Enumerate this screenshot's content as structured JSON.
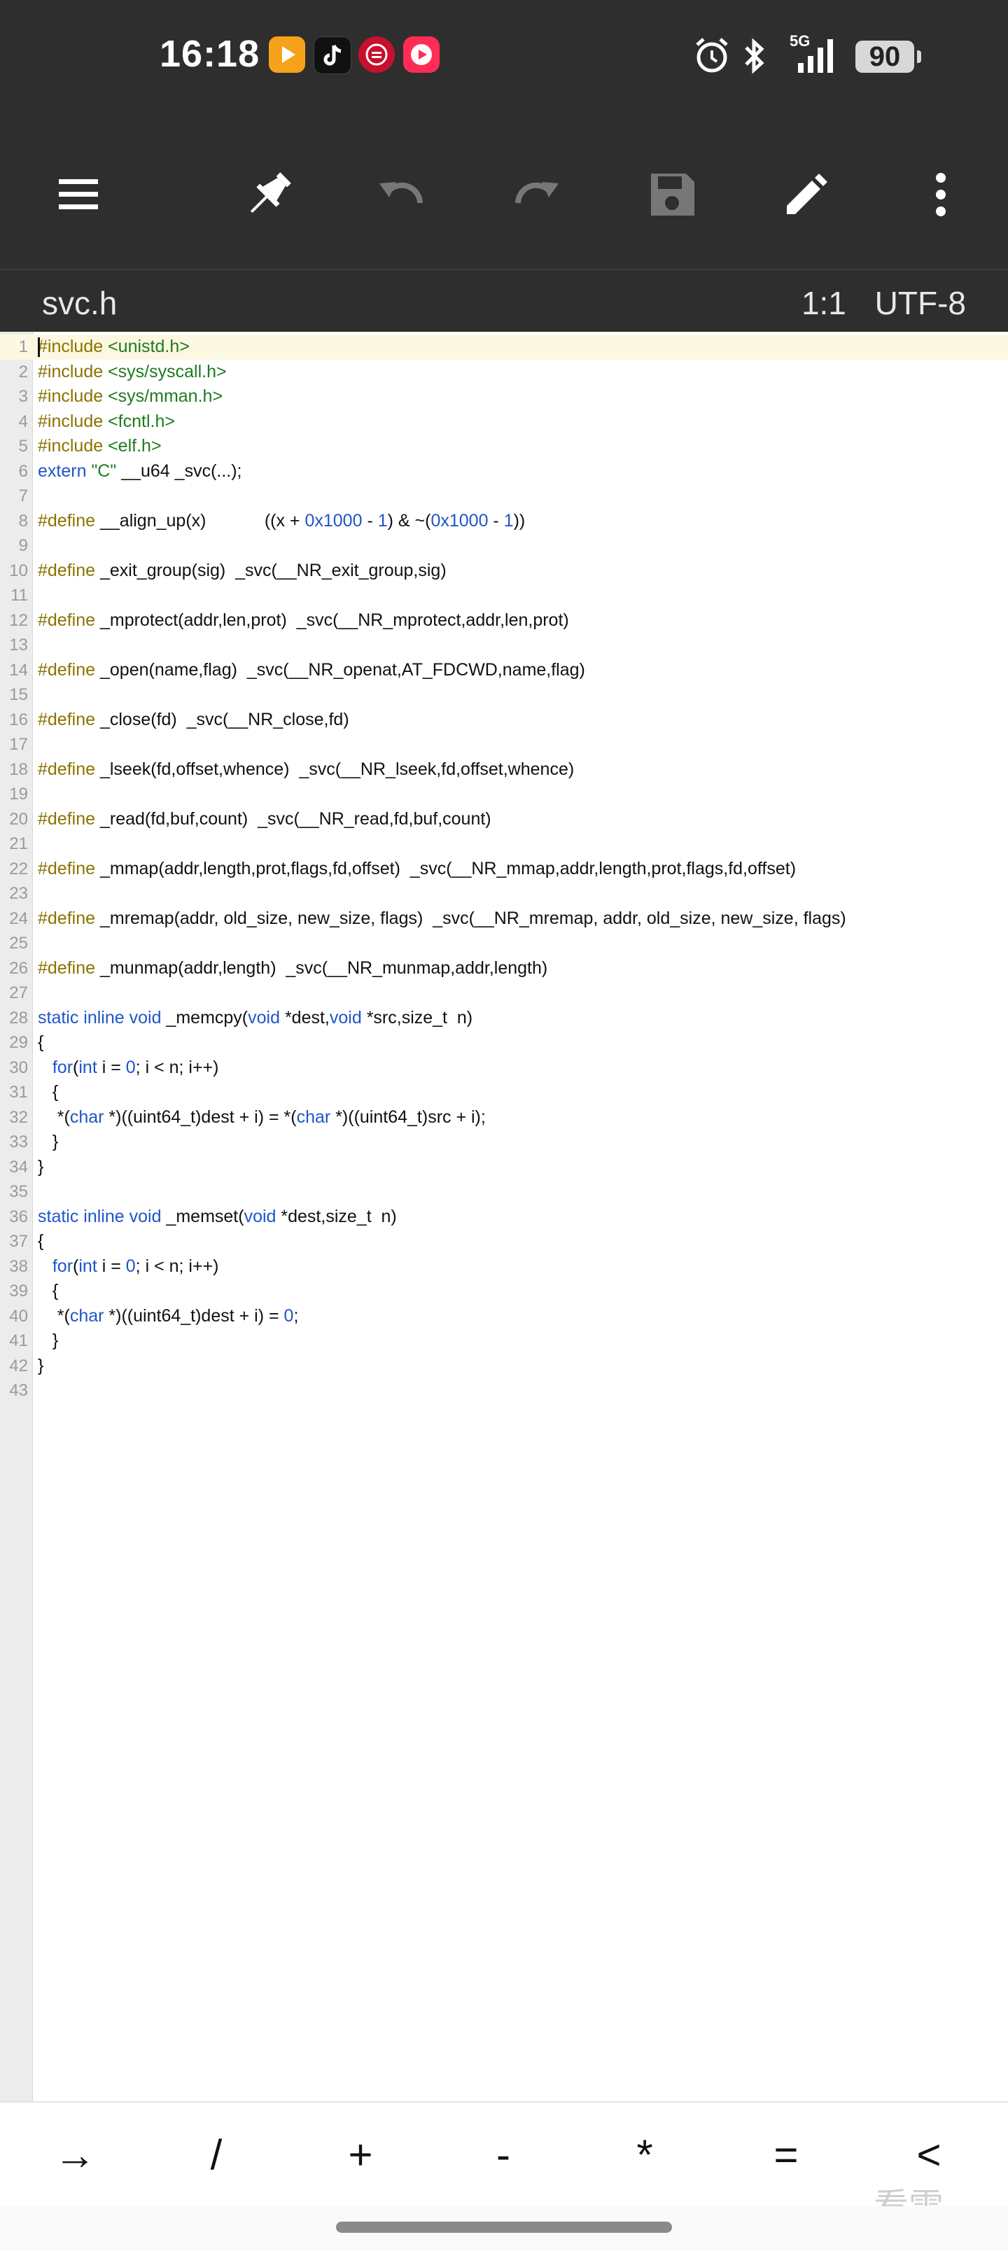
{
  "status_bar": {
    "time": "16:18",
    "network": "5G",
    "battery": "90",
    "app_icons": [
      "video-app-icon",
      "tiktok-icon",
      "red-circle-app-icon",
      "red-play-app-icon"
    ],
    "system_icons": [
      "alarm-icon",
      "bluetooth-icon",
      "signal-icon"
    ]
  },
  "toolbar": {
    "buttons": [
      "menu-icon",
      "pin-icon",
      "undo-icon",
      "redo-icon",
      "save-icon",
      "edit-icon",
      "more-icon"
    ]
  },
  "tab": {
    "filename": "svc.h",
    "cursor_position": "1:1",
    "encoding": "UTF-8"
  },
  "editor": {
    "lines": [
      [
        {
          "t": "#include",
          "c": "kw"
        },
        {
          "t": " <unistd.h>",
          "c": "inc"
        }
      ],
      [
        {
          "t": "#include",
          "c": "kw"
        },
        {
          "t": " <sys/syscall.h>",
          "c": "inc"
        }
      ],
      [
        {
          "t": "#include",
          "c": "kw"
        },
        {
          "t": " <sys/mman.h>",
          "c": "inc"
        }
      ],
      [
        {
          "t": "#include",
          "c": "kw"
        },
        {
          "t": " <fcntl.h>",
          "c": "inc"
        }
      ],
      [
        {
          "t": "#include",
          "c": "kw"
        },
        {
          "t": " <elf.h>",
          "c": "inc"
        }
      ],
      [
        {
          "t": "extern ",
          "c": "ty"
        },
        {
          "t": "\"C\"",
          "c": "str"
        },
        {
          "t": " __u64 _svc(...);",
          "c": "pl"
        }
      ],
      [],
      [
        {
          "t": "#define",
          "c": "kw"
        },
        {
          "t": " __align_up(x)            ((x + ",
          "c": "pl"
        },
        {
          "t": "0x1000",
          "c": "num"
        },
        {
          "t": " - ",
          "c": "pl"
        },
        {
          "t": "1",
          "c": "num"
        },
        {
          "t": ") & ~(",
          "c": "pl"
        },
        {
          "t": "0x1000",
          "c": "num"
        },
        {
          "t": " - ",
          "c": "pl"
        },
        {
          "t": "1",
          "c": "num"
        },
        {
          "t": "))",
          "c": "pl"
        }
      ],
      [],
      [
        {
          "t": "#define",
          "c": "kw"
        },
        {
          "t": " _exit_group(sig)  _svc(__NR_exit_group,sig)",
          "c": "pl"
        }
      ],
      [],
      [
        {
          "t": "#define",
          "c": "kw"
        },
        {
          "t": " _mprotect(addr,len,prot)  _svc(__NR_mprotect,addr,len,prot)",
          "c": "pl"
        }
      ],
      [],
      [
        {
          "t": "#define",
          "c": "kw"
        },
        {
          "t": " _open(name,flag)  _svc(__NR_openat,AT_FDCWD,name,flag)",
          "c": "pl"
        }
      ],
      [],
      [
        {
          "t": "#define",
          "c": "kw"
        },
        {
          "t": " _close(fd)  _svc(__NR_close,fd)",
          "c": "pl"
        }
      ],
      [],
      [
        {
          "t": "#define",
          "c": "kw"
        },
        {
          "t": " _lseek(fd,offset,whence)  _svc(__NR_lseek,fd,offset,whence)",
          "c": "pl"
        }
      ],
      [],
      [
        {
          "t": "#define",
          "c": "kw"
        },
        {
          "t": " _read(fd,buf,count)  _svc(__NR_read,fd,buf,count)",
          "c": "pl"
        }
      ],
      [],
      [
        {
          "t": "#define",
          "c": "kw"
        },
        {
          "t": " _mmap(addr,length,prot,flags,fd,offset)  _svc(__NR_mmap,addr,length,prot,flags,fd,offset)",
          "c": "pl"
        }
      ],
      [],
      [
        {
          "t": "#define",
          "c": "kw"
        },
        {
          "t": " _mremap(addr, old_size, new_size, flags)  _svc(__NR_mremap, addr, old_size, new_size, flags)",
          "c": "pl"
        }
      ],
      [],
      [
        {
          "t": "#define",
          "c": "kw"
        },
        {
          "t": " _munmap(addr,length)  _svc(__NR_munmap,addr,length)",
          "c": "pl"
        }
      ],
      [],
      [
        {
          "t": "static inline void",
          "c": "ty"
        },
        {
          "t": " _memcpy(",
          "c": "pl"
        },
        {
          "t": "void",
          "c": "ty"
        },
        {
          "t": " *dest,",
          "c": "pl"
        },
        {
          "t": "void",
          "c": "ty"
        },
        {
          "t": " *src,size_t  n)",
          "c": "pl"
        }
      ],
      [
        {
          "t": "{",
          "c": "pl"
        }
      ],
      [
        {
          "t": "   ",
          "c": "pl"
        },
        {
          "t": "for",
          "c": "ty"
        },
        {
          "t": "(",
          "c": "pl"
        },
        {
          "t": "int",
          "c": "ty"
        },
        {
          "t": " i = ",
          "c": "pl"
        },
        {
          "t": "0",
          "c": "num"
        },
        {
          "t": "; i < n; i++)",
          "c": "pl"
        }
      ],
      [
        {
          "t": "   {",
          "c": "pl"
        }
      ],
      [
        {
          "t": "    *(",
          "c": "pl"
        },
        {
          "t": "char",
          "c": "ty"
        },
        {
          "t": " *)((uint64_t)dest + i) = *(",
          "c": "pl"
        },
        {
          "t": "char",
          "c": "ty"
        },
        {
          "t": " *)((uint64_t)src + i);",
          "c": "pl"
        }
      ],
      [
        {
          "t": "   }",
          "c": "pl"
        }
      ],
      [
        {
          "t": "}",
          "c": "pl"
        }
      ],
      [],
      [
        {
          "t": "static inline void",
          "c": "ty"
        },
        {
          "t": " _memset(",
          "c": "pl"
        },
        {
          "t": "void",
          "c": "ty"
        },
        {
          "t": " *dest,size_t  n)",
          "c": "pl"
        }
      ],
      [
        {
          "t": "{",
          "c": "pl"
        }
      ],
      [
        {
          "t": "   ",
          "c": "pl"
        },
        {
          "t": "for",
          "c": "ty"
        },
        {
          "t": "(",
          "c": "pl"
        },
        {
          "t": "int",
          "c": "ty"
        },
        {
          "t": " i = ",
          "c": "pl"
        },
        {
          "t": "0",
          "c": "num"
        },
        {
          "t": "; i < n; i++)",
          "c": "pl"
        }
      ],
      [
        {
          "t": "   {",
          "c": "pl"
        }
      ],
      [
        {
          "t": "    *(",
          "c": "pl"
        },
        {
          "t": "char",
          "c": "ty"
        },
        {
          "t": " *)((uint64_t)dest + i) = ",
          "c": "pl"
        },
        {
          "t": "0",
          "c": "num"
        },
        {
          "t": ";",
          "c": "pl"
        }
      ],
      [
        {
          "t": "   }",
          "c": "pl"
        }
      ],
      [
        {
          "t": "}",
          "c": "pl"
        }
      ],
      []
    ]
  },
  "keybar": {
    "keys": [
      "→",
      "/",
      "+",
      "-",
      "*",
      "=",
      "<"
    ]
  },
  "watermark": "看雪",
  "colors": {
    "toolbar_bg": "#2e2e2e",
    "keyword": "#8b7300",
    "include": "#1f7a1f",
    "number": "#1f56c7",
    "active_line": "#fdf8e2"
  }
}
